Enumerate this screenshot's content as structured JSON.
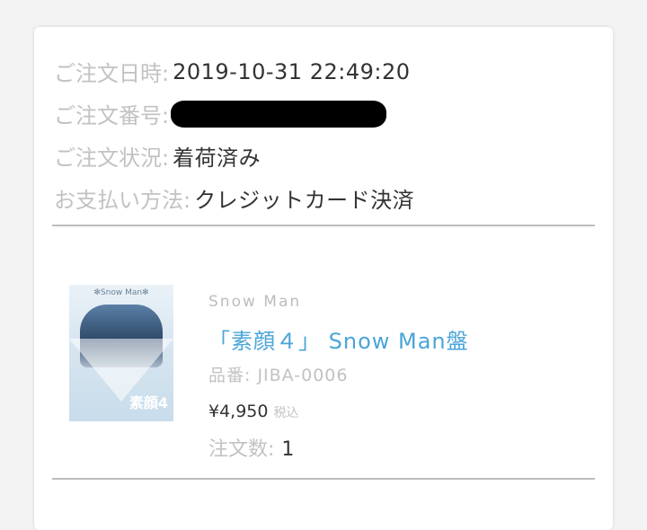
{
  "order": {
    "date_label": "ご注文日時:",
    "date_value": "2019-10-31 22:49:20",
    "number_label": "ご注文番号:",
    "status_label": "ご注文状況:",
    "status_value": "着荷済み",
    "payment_label": "お支払い方法:",
    "payment_value": "クレジットカード決済"
  },
  "product": {
    "artist": "Snow Man",
    "title": "「素顔４」 Snow Man盤",
    "code": "品番: JIBA-0006",
    "price": "¥4,950",
    "tax_note": "税込",
    "quantity_label": "注文数:",
    "quantity_value": "1",
    "thumb_logo": "✻Snow Man✻",
    "thumb_mark": "素顔4"
  },
  "colors": {
    "label_gray": "#c2c2c2",
    "link_blue": "#4aa5d8",
    "divider": "#bdbdbd"
  }
}
